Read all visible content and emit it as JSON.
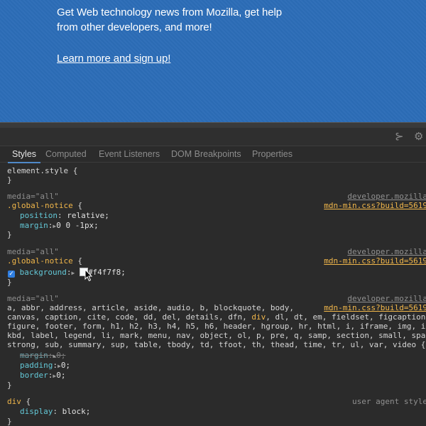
{
  "banner": {
    "line1": "Get Web technology news from Mozilla, get help",
    "line2": "from other developers, and more!",
    "link": "Learn more and sign up!"
  },
  "toolbar": {
    "icons": [
      "list-indent-icon",
      "gear-icon"
    ],
    "glyphs": {
      "list": "⊱",
      "gear": "⚙"
    }
  },
  "tabs": [
    "Styles",
    "Computed",
    "Event Listeners",
    "DOM Breakpoints",
    "Properties"
  ],
  "rules": {
    "element_style": {
      "selector": "element.style {",
      "close": "}"
    },
    "r1": {
      "media": "media=\"all\"",
      "source_loc": "developer.mozilla",
      "source_file": "mdn-min.css?build=5619",
      "selector": ".global-notice",
      "open": " {",
      "decls": [
        {
          "prop": "position",
          "value": " relative;"
        },
        {
          "prop": "margin",
          "value": "0 0 -1px;"
        }
      ],
      "close": "}"
    },
    "r2": {
      "media": "media=\"all\"",
      "source_loc": "developer.mozilla",
      "source_file": "mdn-min.css?build=5619",
      "selector": ".global-notice",
      "open": " {",
      "decl_prop": "background",
      "decl_value": "#f4f7f8;",
      "checkbox": "✓",
      "close": "}"
    },
    "r3": {
      "media": "media=\"all\"",
      "source_loc": "developer.mozilla",
      "source_file": "mdn-min.css?build=5619",
      "sel_line1": "a, abbr, address, article, aside, audio, b, blockquote, body,",
      "sel_line2_a": "canvas, caption, cite, code, dd, del, details, dfn, ",
      "sel_line2_div": "div",
      "sel_line2_b": ", dl, dt, em, fieldset, figcaption,",
      "sel_line3": "figure, footer, form, h1, h2, h3, h4, h5, h6, header, hgroup, hr, html, i, iframe, img, i",
      "sel_line4": "kbd, label, legend, li, mark, menu, nav, object, ol, p, pre, q, samp, section, small, spa",
      "sel_line5": "strong, sub, summary, sup, table, tbody, td, tfoot, th, thead, time, tr, ul, var, video {",
      "decls": [
        {
          "prop": "margin",
          "value": "0;",
          "overridden": true
        },
        {
          "prop": "padding",
          "value": "0;",
          "overridden": false
        },
        {
          "prop": "border",
          "value": "0;",
          "overridden": false
        }
      ],
      "close": "}"
    },
    "r4": {
      "selector": "div",
      "open": " {",
      "source": "user agent style",
      "decl_prop": "display",
      "decl_value": " block;",
      "close": "}"
    }
  },
  "colors": {
    "banner_bg": "#2c6db7",
    "selector": "#f0b64a",
    "property": "#63c7d6",
    "active_tab_underline": "#4f89c9",
    "swatch": "#f4f7f8"
  }
}
